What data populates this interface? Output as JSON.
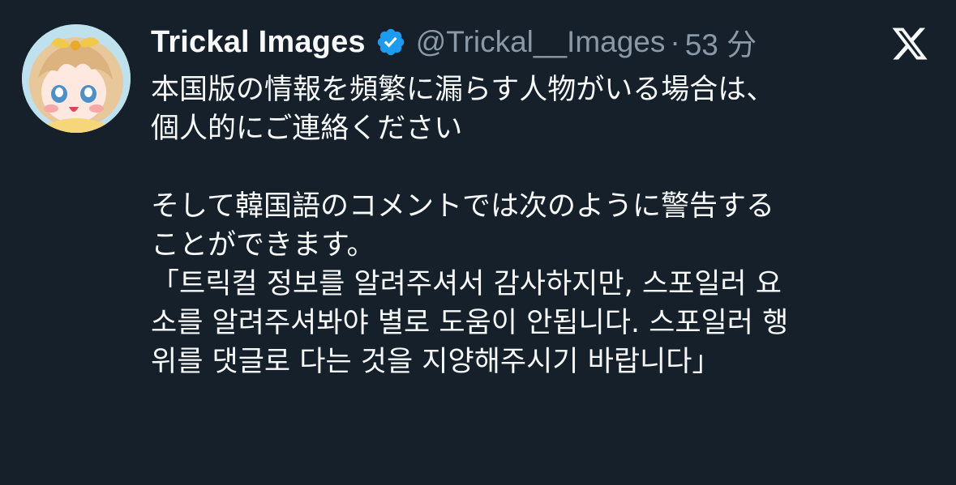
{
  "tweet": {
    "display_name": "Trickal Images",
    "handle": "@Trickal__Images",
    "separator": "·",
    "time": "53 分",
    "verified_icon": "verified-badge-icon",
    "platform_icon": "x-logo-icon",
    "accent_color": "#1d9bf0",
    "background_color": "#15202b",
    "text_color": "#f7f9f9",
    "muted_color": "#8b98a5"
  },
  "body": {
    "lines": [
      "本国版の情報を頻繁に漏らす人物がいる場合は、",
      "個人的にご連絡ください",
      "",
      "そして韓国語のコメントでは次のように警告する",
      "ことができます。",
      "「트릭컬 정보를 알려주셔서 감사하지만, 스포일러 요",
      "소를 알려주셔봐야 별로 도움이 안됩니다. 스포일러 행",
      "위를 댓글로 다는 것을 지양해주시기 바랍니다」"
    ]
  }
}
